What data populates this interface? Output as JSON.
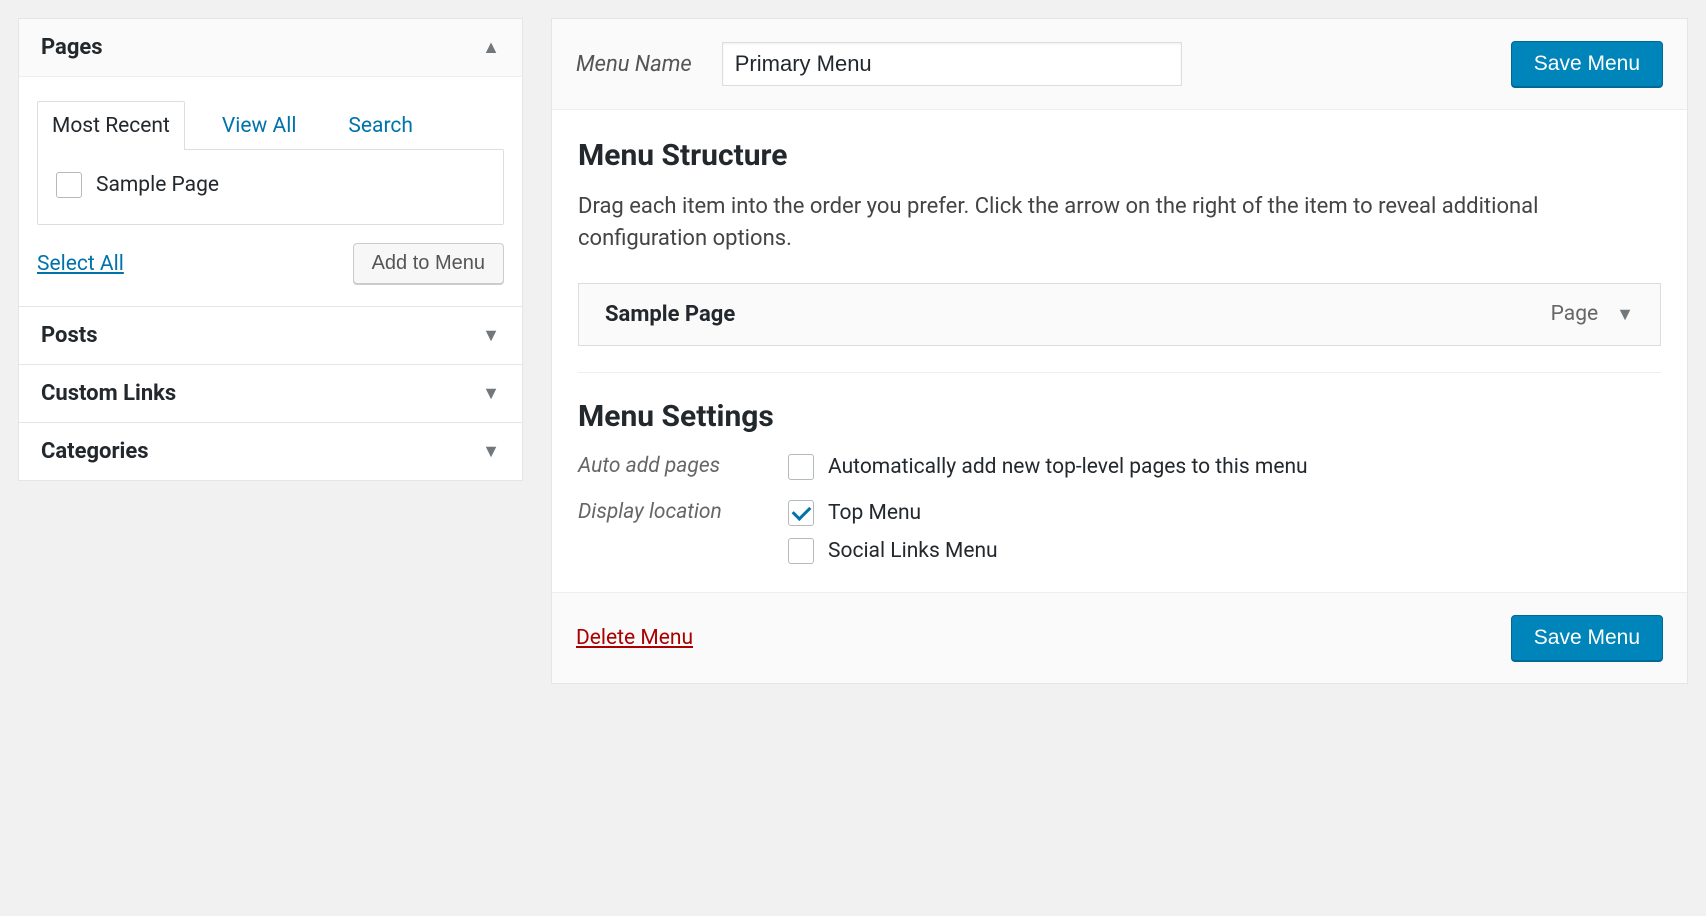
{
  "left": {
    "pages": {
      "title": "Pages",
      "expanded": true,
      "tabs": {
        "most_recent": "Most Recent",
        "view_all": "View All",
        "search": "Search"
      },
      "items": [
        {
          "label": "Sample Page",
          "checked": false
        }
      ],
      "select_all": "Select All",
      "add_to_menu": "Add to Menu"
    },
    "posts": {
      "title": "Posts"
    },
    "custom_links": {
      "title": "Custom Links"
    },
    "categories": {
      "title": "Categories"
    }
  },
  "menu": {
    "name_label": "Menu Name",
    "name_value": "Primary Menu",
    "save_label": "Save Menu",
    "structure": {
      "heading": "Menu Structure",
      "description": "Drag each item into the order you prefer. Click the arrow on the right of the item to reveal additional configuration options.",
      "items": [
        {
          "title": "Sample Page",
          "type": "Page"
        }
      ]
    },
    "settings": {
      "heading": "Menu Settings",
      "auto_add": {
        "label": "Auto add pages",
        "option": "Automatically add new top-level pages to this menu",
        "checked": false
      },
      "display_location": {
        "label": "Display location",
        "options": [
          {
            "label": "Top Menu",
            "checked": true
          },
          {
            "label": "Social Links Menu",
            "checked": false
          }
        ]
      }
    },
    "delete_label": "Delete Menu"
  }
}
